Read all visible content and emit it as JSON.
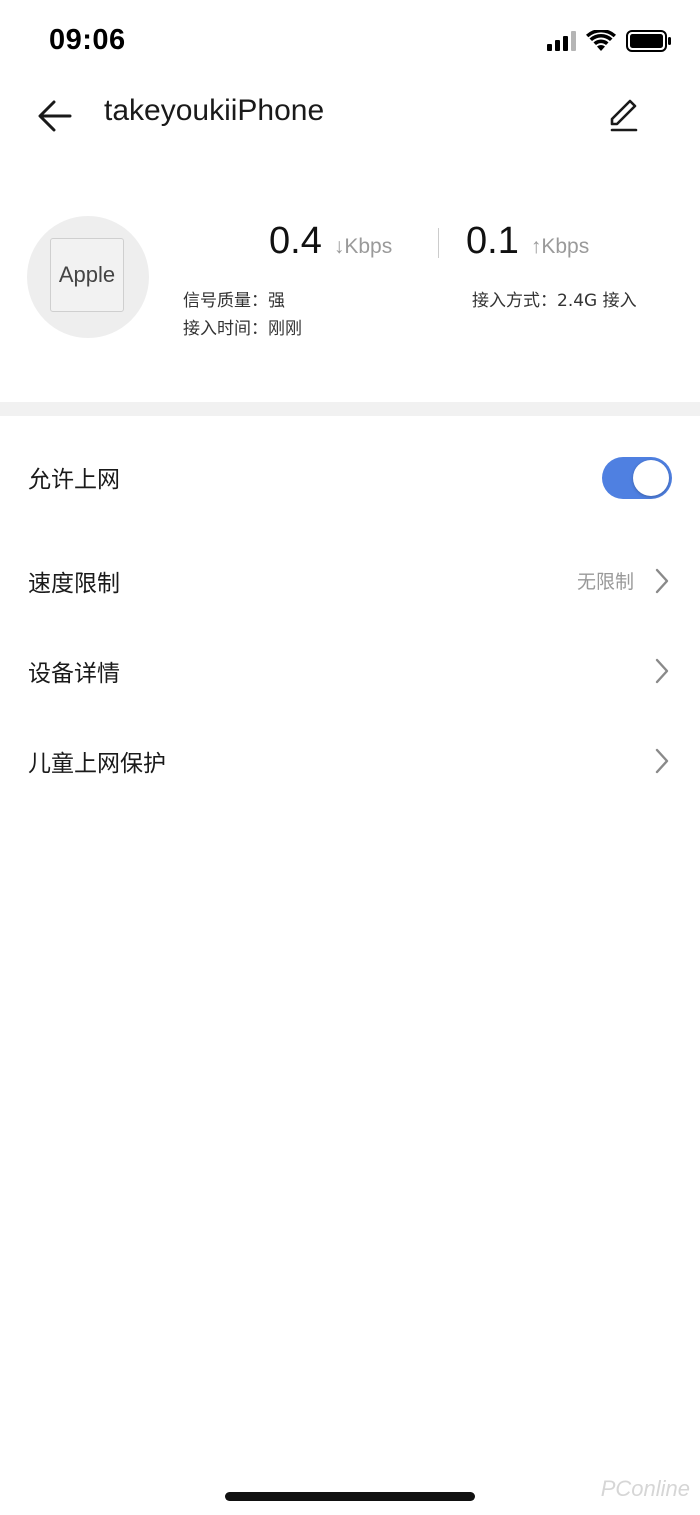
{
  "status_bar": {
    "time": "09:06",
    "icons": [
      "cellular-signal-icon",
      "wifi-icon",
      "battery-icon"
    ]
  },
  "header": {
    "title": "takeyoukiiPhone",
    "back_icon": "arrow-left-icon",
    "edit_icon": "edit-pencil-icon"
  },
  "device": {
    "brand": "Apple",
    "download": {
      "value": "0.4",
      "unit": "↓Kbps"
    },
    "upload": {
      "value": "0.1",
      "unit": "↑Kbps"
    },
    "signal_quality": "信号质量：强",
    "access_time": "接入时间：刚刚",
    "access_mode": "接入方式：2.4G 接入"
  },
  "settings": {
    "allow_internet": {
      "label": "允许上网",
      "enabled": true
    },
    "speed_limit": {
      "label": "速度限制",
      "value": "无限制"
    },
    "device_details": {
      "label": "设备详情"
    },
    "child_protection": {
      "label": "儿童上网保护"
    }
  },
  "watermark": "PConline",
  "colors": {
    "accent": "#4f80e1",
    "secondary_text": "#999999",
    "separator": "#f1f1f1"
  }
}
